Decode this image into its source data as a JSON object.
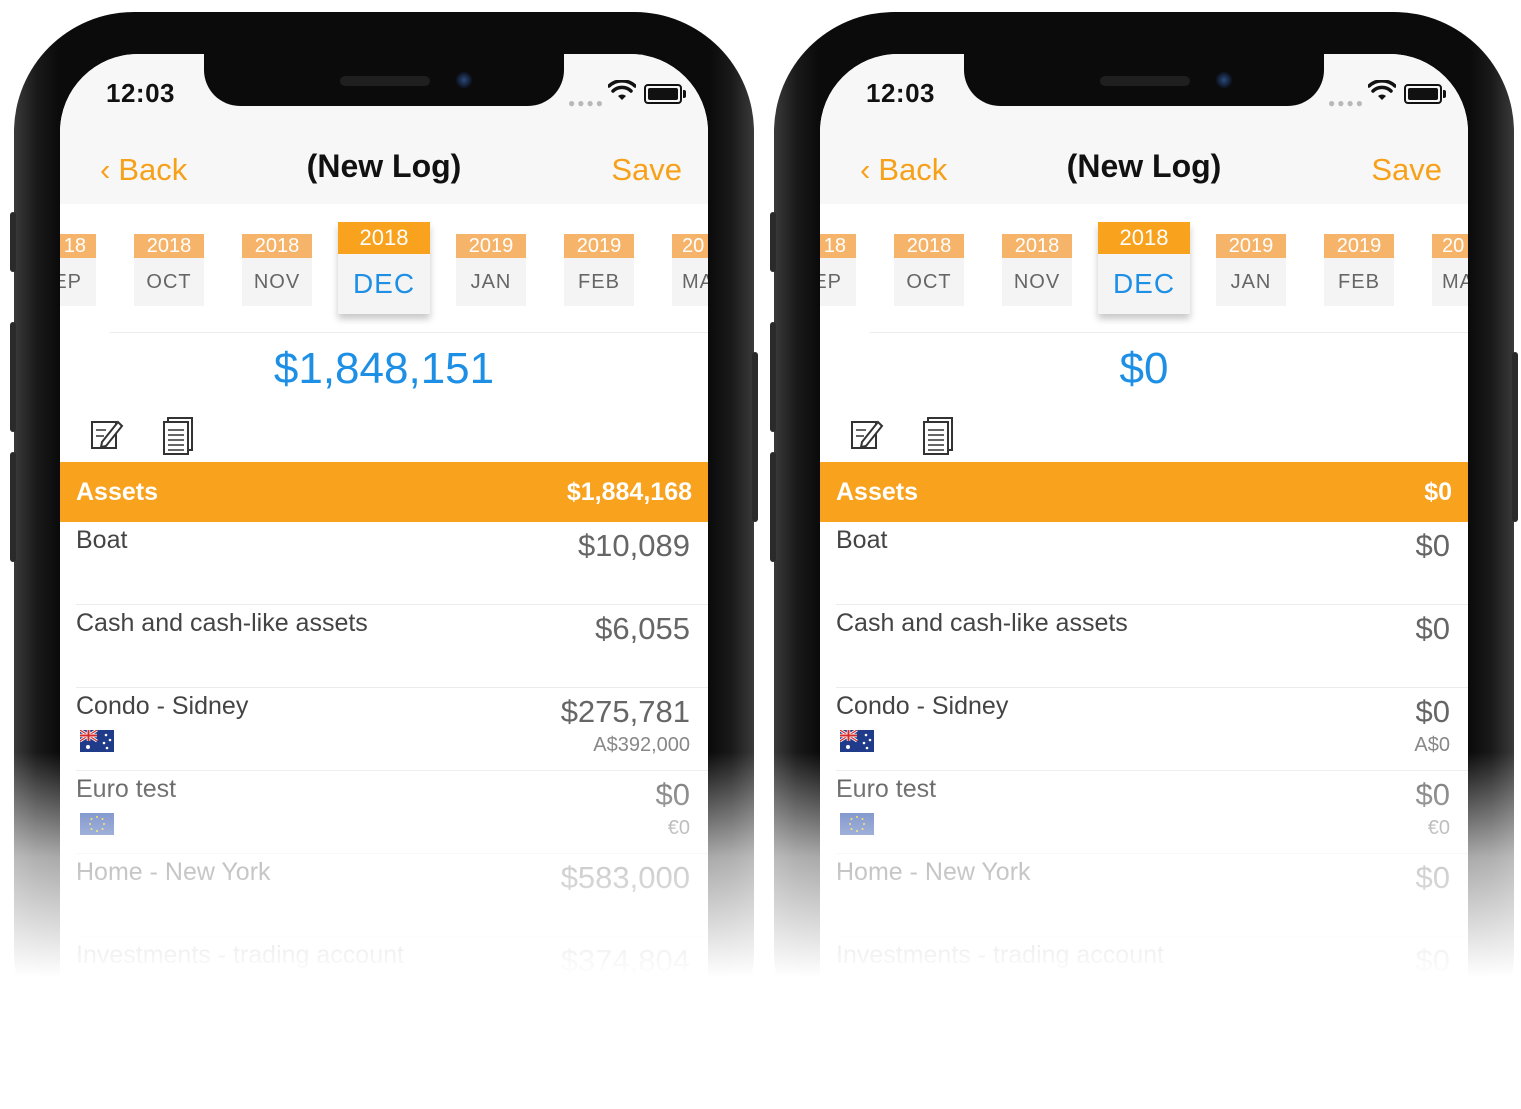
{
  "colors": {
    "accent": "#f8a21e",
    "blue": "#1d8fe5"
  },
  "phones": [
    {
      "status": {
        "time": "12:03"
      },
      "nav": {
        "back": "Back",
        "title": "(New Log)",
        "save": "Save"
      },
      "months": [
        {
          "year": "18",
          "month": "EP"
        },
        {
          "year": "2018",
          "month": "OCT"
        },
        {
          "year": "2018",
          "month": "NOV"
        },
        {
          "year": "2018",
          "month": "DEC"
        },
        {
          "year": "2019",
          "month": "JAN"
        },
        {
          "year": "2019",
          "month": "FEB"
        },
        {
          "year": "20",
          "month": "MA"
        }
      ],
      "total": "$1,848,151",
      "assets": {
        "label": "Assets",
        "value": "$1,884,168"
      },
      "rows": [
        {
          "name": "Boat",
          "amount": "$10,089",
          "sub": ""
        },
        {
          "name": "Cash and cash-like assets",
          "amount": "$6,055",
          "sub": ""
        },
        {
          "name": "Condo - Sidney",
          "amount": "$275,781",
          "sub": "A$392,000",
          "flag": "australia-flag-icon"
        },
        {
          "name": "Euro test",
          "amount": "$0",
          "sub": "€0",
          "flag": "eu-flag-icon"
        },
        {
          "name": "Home - New York",
          "amount": "$583,000",
          "sub": ""
        },
        {
          "name": "Investments - trading account",
          "amount": "$374,804",
          "sub": ""
        }
      ]
    },
    {
      "status": {
        "time": "12:03"
      },
      "nav": {
        "back": "Back",
        "title": "(New Log)",
        "save": "Save"
      },
      "months": [
        {
          "year": "18",
          "month": "EP"
        },
        {
          "year": "2018",
          "month": "OCT"
        },
        {
          "year": "2018",
          "month": "NOV"
        },
        {
          "year": "2018",
          "month": "DEC"
        },
        {
          "year": "2019",
          "month": "JAN"
        },
        {
          "year": "2019",
          "month": "FEB"
        },
        {
          "year": "20",
          "month": "MA"
        }
      ],
      "total": "$0",
      "assets": {
        "label": "Assets",
        "value": "$0"
      },
      "rows": [
        {
          "name": "Boat",
          "amount": "$0",
          "sub": ""
        },
        {
          "name": "Cash and cash-like assets",
          "amount": "$0",
          "sub": ""
        },
        {
          "name": "Condo - Sidney",
          "amount": "$0",
          "sub": "A$0",
          "flag": "australia-flag-icon"
        },
        {
          "name": "Euro test",
          "amount": "$0",
          "sub": "€0",
          "flag": "eu-flag-icon"
        },
        {
          "name": "Home - New York",
          "amount": "$0",
          "sub": ""
        },
        {
          "name": "Investments - trading account",
          "amount": "$0",
          "sub": ""
        }
      ]
    }
  ]
}
